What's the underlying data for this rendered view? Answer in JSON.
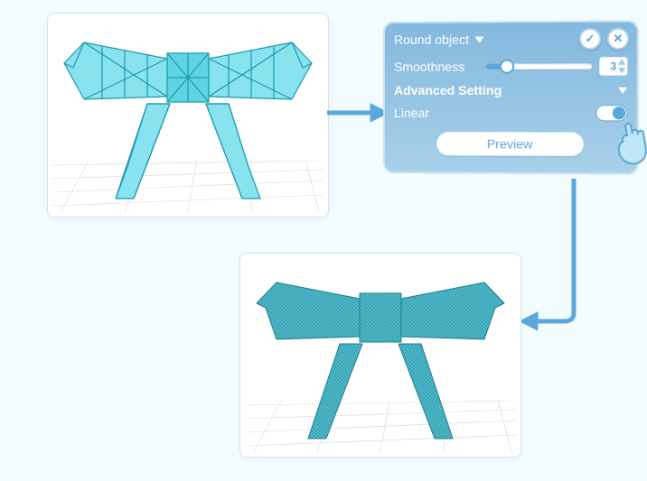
{
  "panel": {
    "title": "Round  object",
    "smoothness_label": "Smoothness",
    "smoothness_value": "3",
    "advanced_label": "Advanced Setting",
    "linear_label": "Linear",
    "linear_on": true,
    "preview_label": "Preview"
  },
  "icons": {
    "confirm": "✓",
    "cancel": "✕"
  },
  "frames": {
    "before_desc": "Low-poly faceted bow preview",
    "after_desc": "Subdivided smooth bow preview"
  },
  "colors": {
    "accent": "#5aa8d9",
    "bow_fill": "#89e3ef",
    "bow_line": "#1a9aaf"
  }
}
